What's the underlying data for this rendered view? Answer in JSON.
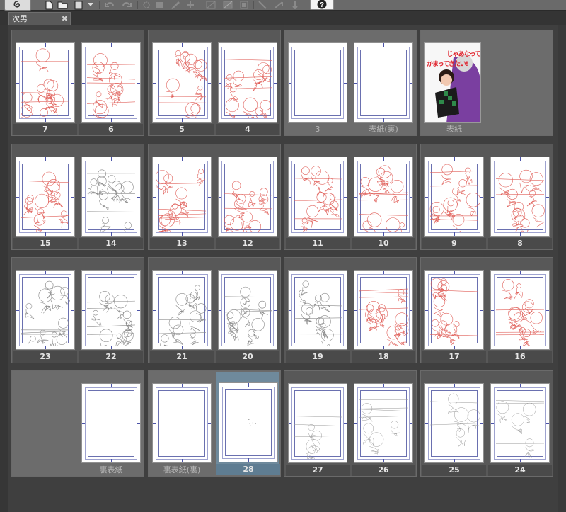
{
  "tab": {
    "title": "次男",
    "close_glyph": "✖"
  },
  "toolbar": {
    "icons": [
      "app-logo-icon",
      "new-file-icon",
      "open-folder-icon",
      "page-icon",
      "dropdown-icon",
      "undo-icon",
      "redo-icon",
      "transform-icon",
      "fill-icon",
      "pen-icon",
      "select-icon",
      "line-icon",
      "tone-icon",
      "frame-icon",
      "ruler-icon",
      "arrow-icon",
      "misc-icon",
      "help-icon"
    ]
  },
  "colors": {
    "sketch_red": "#e0605a",
    "sketch_gray": "#8a8a8a",
    "frame_blue": "#6a70b0",
    "selected": "#6f8a9c"
  },
  "rows": [
    [
      {
        "pages": [
          {
            "label": "7",
            "sketch": "red"
          },
          {
            "label": "6",
            "sketch": "red"
          }
        ]
      },
      {
        "pages": [
          {
            "label": "5",
            "sketch": "red"
          },
          {
            "label": "4",
            "sketch": "red"
          }
        ]
      },
      {
        "pages": [
          {
            "label": "3",
            "sketch": "blank",
            "dim": true
          },
          {
            "label": "表紙(裏)",
            "sketch": "blank",
            "dim": true
          }
        ],
        "light": true
      },
      {
        "pages": [
          {
            "label": "表紙",
            "sketch": "cover",
            "dim": true
          }
        ],
        "light": true
      }
    ],
    [
      {
        "pages": [
          {
            "label": "15",
            "sketch": "red"
          },
          {
            "label": "14",
            "sketch": "gray"
          }
        ]
      },
      {
        "pages": [
          {
            "label": "13",
            "sketch": "red"
          },
          {
            "label": "12",
            "sketch": "red"
          }
        ]
      },
      {
        "pages": [
          {
            "label": "11",
            "sketch": "red"
          },
          {
            "label": "10",
            "sketch": "red"
          }
        ]
      },
      {
        "pages": [
          {
            "label": "9",
            "sketch": "red"
          },
          {
            "label": "8",
            "sketch": "red"
          }
        ]
      }
    ],
    [
      {
        "pages": [
          {
            "label": "23",
            "sketch": "gray"
          },
          {
            "label": "22",
            "sketch": "gray"
          }
        ]
      },
      {
        "pages": [
          {
            "label": "21",
            "sketch": "gray"
          },
          {
            "label": "20",
            "sketch": "gray"
          }
        ]
      },
      {
        "pages": [
          {
            "label": "19",
            "sketch": "gray"
          },
          {
            "label": "18",
            "sketch": "red"
          }
        ]
      },
      {
        "pages": [
          {
            "label": "17",
            "sketch": "red"
          },
          {
            "label": "16",
            "sketch": "red"
          }
        ]
      }
    ],
    [
      {
        "pages": [
          {
            "label": "",
            "sketch": "none"
          },
          {
            "label": "裏表紙",
            "sketch": "blank",
            "dim": true
          }
        ],
        "light": true
      },
      {
        "pages": [
          {
            "label": "裏表紙(裏)",
            "sketch": "blank",
            "dim": true
          },
          {
            "label": "28",
            "sketch": "dots",
            "selected": true
          }
        ],
        "light": true
      },
      {
        "pages": [
          {
            "label": "27",
            "sketch": "light"
          },
          {
            "label": "26",
            "sketch": "light"
          }
        ]
      },
      {
        "pages": [
          {
            "label": "25",
            "sketch": "light"
          },
          {
            "label": "24",
            "sketch": "light"
          }
        ]
      }
    ]
  ],
  "cover": {
    "title_lines": [
      "じゃあなって",
      "かまってきたい!"
    ],
    "colors": {
      "title": "#e0202a",
      "bg": "#f7f7f7",
      "jacket_purple": "#7a3fa0",
      "checker_green": "#2f8a4a"
    }
  }
}
